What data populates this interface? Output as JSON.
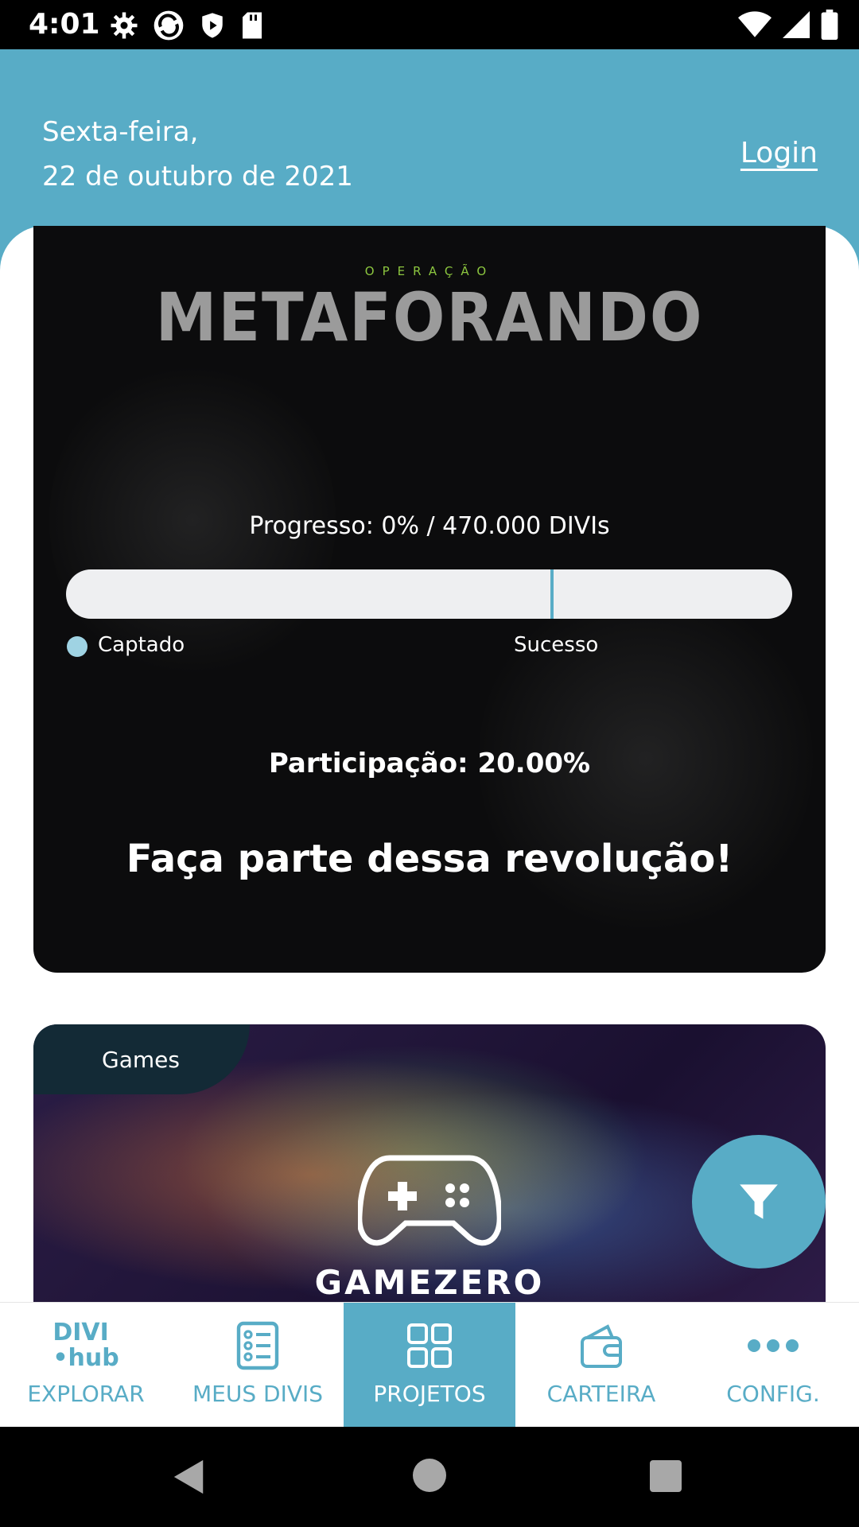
{
  "status_bar": {
    "time": "4:01",
    "icons": [
      "gear-icon",
      "sync-icon",
      "shield-icon",
      "sdcard-icon",
      "wifi-icon",
      "signal-icon",
      "battery-icon"
    ]
  },
  "header": {
    "date_line1": "Sexta-feira,",
    "date_line2": "22 de outubro de 2021",
    "login_label": "Login"
  },
  "project_card_1": {
    "logo_small": "OPERAÇÃO",
    "logo_big": "METAFORANDO",
    "progress_label": "Progresso: 0% / 470.000 DIVIs",
    "progress_fraction": 0,
    "legend_captado": "Captado",
    "legend_sucesso": "Sucesso",
    "participacao": "Participação: 20.00%",
    "cta": "Faça parte dessa revolução!"
  },
  "project_card_2": {
    "category": "Games",
    "logo_text": "GAMEZERO"
  },
  "fab": {
    "icon": "filter-icon"
  },
  "bottom_nav": {
    "items": [
      {
        "label": "EXPLORAR",
        "icon": "divihub-logo",
        "logo_line1": "DIVI",
        "logo_line2": "•hub"
      },
      {
        "label": "MEUS DIVIS",
        "icon": "list-icon"
      },
      {
        "label": "PROJETOS",
        "icon": "grid-icon"
      },
      {
        "label": "CARTEIRA",
        "icon": "wallet-icon"
      },
      {
        "label": "CONFIG.",
        "icon": "more-icon"
      }
    ],
    "active_index": 2
  },
  "colors": {
    "accent": "#58acc6",
    "progress_fill": "#9fd3e3",
    "logo_green": "#8cc63f",
    "tag_bg": "#132a36"
  }
}
